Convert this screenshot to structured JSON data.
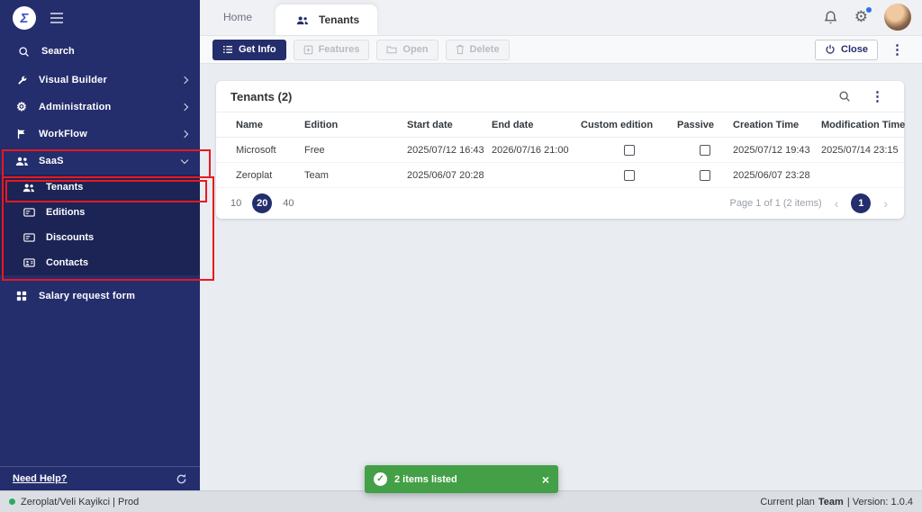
{
  "app": {
    "logo_glyph": "Ʃ",
    "tabs": [
      {
        "label": "Home"
      },
      {
        "label": "Tenants"
      }
    ]
  },
  "sidebar": {
    "search_label": "Search",
    "items": [
      {
        "label": "Visual Builder"
      },
      {
        "label": "Administration"
      },
      {
        "label": "WorkFlow"
      },
      {
        "label": "SaaS"
      },
      {
        "label": "Salary request form"
      }
    ],
    "saas_children": [
      {
        "label": "Tenants"
      },
      {
        "label": "Editions"
      },
      {
        "label": "Discounts"
      },
      {
        "label": "Contacts"
      }
    ],
    "need_help": "Need Help?"
  },
  "toolbar": {
    "get_info": "Get Info",
    "features": "Features",
    "open": "Open",
    "delete": "Delete",
    "close": "Close"
  },
  "card": {
    "title": "Tenants (2)"
  },
  "table": {
    "columns": [
      "Name",
      "Edition",
      "Start date",
      "End date",
      "Custom edition",
      "Passive",
      "Creation Time",
      "Modification Time"
    ],
    "rows": [
      {
        "name": "Microsoft",
        "edition": "Free",
        "start_date": "2025/07/12 16:43",
        "end_date": "2026/07/16 21:00",
        "custom_edition": false,
        "passive": false,
        "creation_time": "2025/07/12 19:43",
        "modification_time": "2025/07/14 23:15"
      },
      {
        "name": "Zeroplat",
        "edition": "Team",
        "start_date": "2025/06/07 20:28",
        "end_date": "",
        "custom_edition": false,
        "passive": false,
        "creation_time": "2025/06/07 23:28",
        "modification_time": ""
      }
    ]
  },
  "pagination": {
    "sizes": [
      "10",
      "20",
      "40"
    ],
    "active_size": "20",
    "info": "Page 1 of 1 (2 items)",
    "current_page": "1"
  },
  "toast": {
    "message": "2 items listed"
  },
  "status_bar": {
    "left": "Zeroplat/Veli Kayikci | Prod",
    "plan_label": "Current plan",
    "plan_value": "Team",
    "version": "| Version: 1.0.4"
  },
  "colors": {
    "primary": "#242e6d",
    "annotation": "#e8191f",
    "toast_green": "#43a047"
  }
}
